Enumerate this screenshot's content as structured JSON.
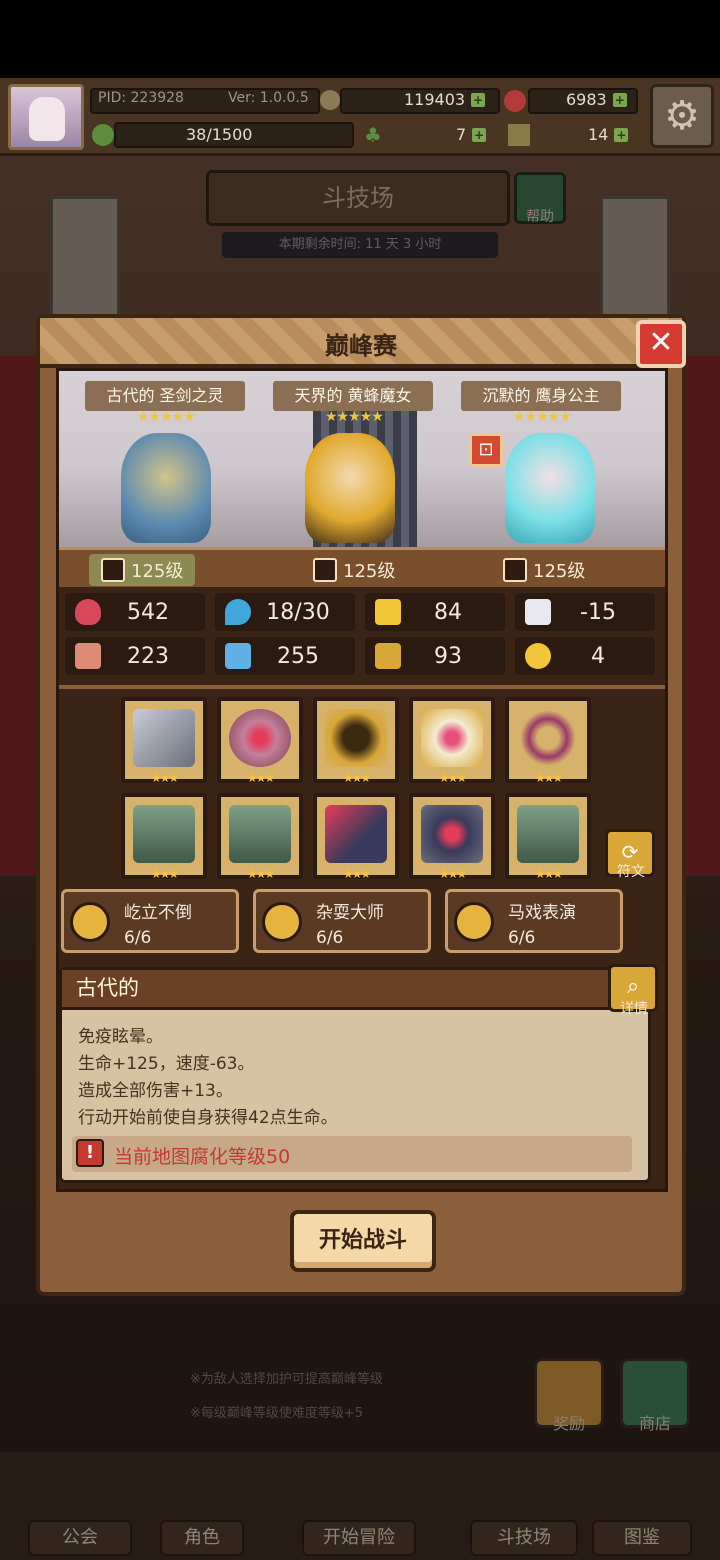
{
  "hud": {
    "pid": "PID: 223928",
    "version": "Ver: 1.0.0.5",
    "gold": "119403",
    "gems": "6983",
    "stamina": "38/1500",
    "clovers": "7",
    "keys": "14"
  },
  "arena": {
    "title": "斗技场",
    "help_label": "帮助",
    "season_remaining": "本期剩余时间: 11 天 3 小时"
  },
  "modal": {
    "title": "巅峰赛",
    "close_label": "✕",
    "heroes": [
      {
        "name": "古代的 圣剑之灵",
        "stars": "★★★★★"
      },
      {
        "name": "天界的 黄蜂魔女",
        "stars": "★★★★★"
      },
      {
        "name": "沉默的 鹰身公主",
        "stars": "★★★★★"
      }
    ],
    "levels": [
      "125级",
      "125级",
      "125级"
    ],
    "stats": {
      "hp": "542",
      "mana": "18/30",
      "defense": "84",
      "speed": "-15",
      "attack": "223",
      "magic": "255",
      "armor": "93",
      "luck": "4"
    },
    "slot_stars": "★★★",
    "rune_label": "符文",
    "sets": [
      {
        "name": "屹立不倒",
        "count": "6/6"
      },
      {
        "name": "杂耍大师",
        "count": "6/6"
      },
      {
        "name": "马戏表演",
        "count": "6/6"
      }
    ],
    "desc": {
      "title": "古代的",
      "detail_label": "详情",
      "lines": [
        "免疫眩晕。",
        "生命+125，速度-63。",
        "造成全部伤害+13。",
        "行动开始前使自身获得42点生命。"
      ],
      "corruption": "当前地图腐化等级50"
    },
    "start_button": "开始战斗"
  },
  "bottom": {
    "note1": "※为敌人选择加护可提高巅峰等级",
    "note2": "※每级巅峰等级使难度等级+5",
    "reward_label": "奖励",
    "shop_label": "商店",
    "nav": [
      "公会",
      "角色",
      "开始冒险",
      "斗技场",
      "图鉴"
    ]
  },
  "colors": {
    "accent_red": "#d53b32",
    "gold": "#d9a638",
    "corruption_text": "#c43a2f"
  }
}
